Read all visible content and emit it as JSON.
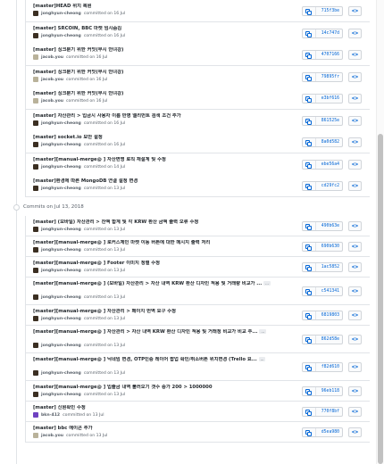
{
  "group1": [
    {
      "title": "[master]HEAD 위치 복원",
      "author": "jonghyun-cheong",
      "when": "committed on 16 Jul",
      "sha": "715f3be",
      "avatar": "#3b2f22"
    },
    {
      "title": "[master] SRCOIN, BBC 마켓 임시숨김",
      "author": "jonghyun-cheong",
      "when": "committed on 16 Jul",
      "sha": "14c747d",
      "avatar": "#3b2f22"
    },
    {
      "title": "[master] 싱크분기 위한 커밋(무시 안녀강)",
      "author": "jacob.you",
      "when": "committed on 16 Jul",
      "sha": "4707166",
      "avatar": "#b9b29a"
    },
    {
      "title": "[master] 싱크분기 위한 커밋(무시 안녀강)",
      "author": "jacob.you",
      "when": "committed on 16 Jul",
      "sha": "79895fr",
      "avatar": "#b9b29a"
    },
    {
      "title": "[master] 싱크분기 위한 커밋(무시 안녀강)",
      "author": "jacob.you",
      "when": "committed on 16 Jul",
      "sha": "e3bf616",
      "avatar": "#b9b29a"
    },
    {
      "title": "[master] 자산관리 > 입금시 사용자 이름 반영 엘리먼트 검색 조건 추가",
      "author": "jonghyun-cheong",
      "when": "committed on 16 Jul",
      "sha": "861525e",
      "avatar": "#3b2f22"
    },
    {
      "title": "[master] socket.io 보안 설정",
      "author": "jonghyun-cheong",
      "when": "committed on 16 Jul",
      "sha": "8a0d582",
      "avatar": "#3b2f22"
    },
    {
      "title": "[master][manual-merge@            ] 자산변명 로직 재설계 및 수정",
      "author": "jonghyun-cheong",
      "when": "committed on 14 Jul",
      "sha": "ebe56a4",
      "avatar": "#3b2f22"
    },
    {
      "title": "[master]환경에 따른 MongoDB 연결 설정 변경",
      "author": "jonghyun-cheong",
      "when": "committed on 13 Jul",
      "sha": "cd29fc2",
      "avatar": "#3b2f22"
    }
  ],
  "date_header": "Commits on Jul 13, 2018",
  "group2": [
    {
      "title": "[master] (모바일) 자산관리 > 잔액 합계 및 각 KRW 환산 금액 출력 오류 수정",
      "author": "jonghyun-cheong",
      "when": "committed on 13 Jul",
      "sha": "490b63e",
      "avatar": "#3b2f22",
      "more": false
    },
    {
      "title": "[master][manual-merge@            ] 로커스체인 마켓 이동 버튼에 대한 메시지 출력 처리",
      "author": "jonghyun-cheong",
      "when": "committed on 13 Jul",
      "sha": "690b630",
      "avatar": "#3b2f22",
      "more": false
    },
    {
      "title": "[master][manual-merge@            ] Footer 이미지 정렬 수정",
      "author": "jonghyun-cheong",
      "when": "committed on 13 Jul",
      "sha": "1ac5852",
      "avatar": "#3b2f22",
      "more": false
    },
    {
      "title": "[master][manual-merge@            ] (모바일) 자산관리 > 자산 내역 KRW 환산 디자인 적용 및 거래량 비교가 ...",
      "author": "jonghyun-cheong",
      "when": "committed on 13 Jul",
      "sha": "c541341",
      "avatar": "#3b2f22",
      "more": true
    },
    {
      "title": "[master][manual-merge@            ] 자산관리 > 페이지 번역 요구 수정",
      "author": "jonghyun-cheong",
      "when": "committed on 13 Jul",
      "sha": "6819803",
      "avatar": "#3b2f22",
      "more": false
    },
    {
      "title": "[master][manual-merge@            ] 자산관리 > 자산 내역 KRW 환산 디자인 적용 및 거래정 비교가 비교 주...",
      "author": "jonghyun-cheong",
      "when": "committed on 13 Jul",
      "sha": "862d58e",
      "avatar": "#3b2f22",
      "more": true
    },
    {
      "title": "[master][manual-merge@            ] 닉네임 변경, OTP인증 레이어 팝업 확인/취소버튼 위치변경 (Trello 요...",
      "author": "jonghyun-cheong",
      "when": "committed on 13 Jul",
      "sha": "f82d610",
      "avatar": "#3b2f22",
      "more": true
    },
    {
      "title": "[master][manual-merge@            ] 입출금 내역 불러오기 갯수 증가 200 > 1000000",
      "author": "jonghyun-cheong",
      "when": "committed on 13 Jul",
      "sha": "96eb118",
      "avatar": "#3b2f22",
      "more": false
    },
    {
      "title": "[master] 신원확인                              수정",
      "author": "bkn-412",
      "when": "committed on 13 Jul",
      "sha": "770f8bf",
      "avatar": "#6f42c1",
      "more": false
    },
    {
      "title": "[master] bbc 에이콘 추가",
      "author": "jacob.you",
      "when": "committed on 13 Jul",
      "sha": "d5ea980",
      "avatar": "#b9b29a",
      "more": false
    }
  ],
  "ellipsis_label": "...",
  "code_label": "<>"
}
